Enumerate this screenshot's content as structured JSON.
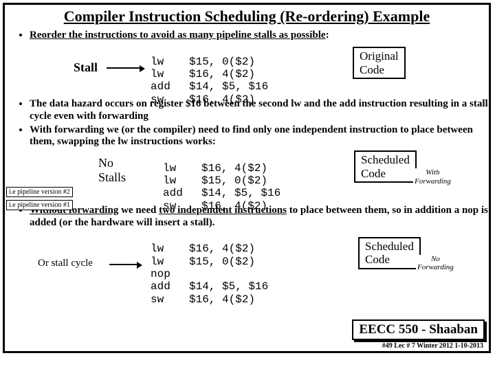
{
  "title": "Compiler Instruction Scheduling (Re-ordering) Example",
  "bullets": {
    "b1_a": "Reorder the instructions to avoid as many pipeline stalls as possible",
    "b2": "The data hazard occurs on register $16 between the second lw and the add instruction resulting in a stall cycle even with forwarding",
    "b3": "With forwarding we (or the compiler) need to find only one independent instruction to place between them, swapping the lw instructions works:",
    "b4_a": "Without forwarding",
    "b4_b": "two independent instructions",
    "b4_c": " we need ",
    "b4_d": " to place between them,  so in addition a nop is added (or the hardware will insert a stall)."
  },
  "labels": {
    "stall": "Stall",
    "nostalls_a": "No",
    "nostalls_b": "Stalls",
    "orstall": "Or stall cycle",
    "orig_a": "Original",
    "orig_b": "Code",
    "sched_a": "Scheduled",
    "sched_b": "Code",
    "with": "With",
    "fwd": "Forwarding",
    "no": "No",
    "pv1": "i.e pipeline version #1",
    "pv2": "i.e pipeline version #2"
  },
  "code": {
    "orig": [
      [
        "lw",
        "$15, 0($2)"
      ],
      [
        "lw",
        "$16, 4($2)"
      ],
      [
        "add",
        "$14, $5, $16"
      ],
      [
        "sw",
        "$16, 4($2)"
      ]
    ],
    "sched1": [
      [
        "lw",
        "$16, 4($2)"
      ],
      [
        "lw",
        "$15, 0($2)"
      ],
      [
        "add",
        "$14, $5, $16"
      ],
      [
        "sw",
        "$16, 4($2)"
      ]
    ],
    "sched2": [
      [
        "lw",
        "$16, 4($2)"
      ],
      [
        "lw",
        "$15, 0($2)"
      ],
      [
        "nop",
        ""
      ],
      [
        "add",
        "$14, $5, $16"
      ],
      [
        "sw",
        "$16, 4($2)"
      ]
    ]
  },
  "footer": {
    "course": "EECC 550 - Shaaban",
    "line": "#49   Lec # 7  Winter 2012   1-10-2013"
  }
}
